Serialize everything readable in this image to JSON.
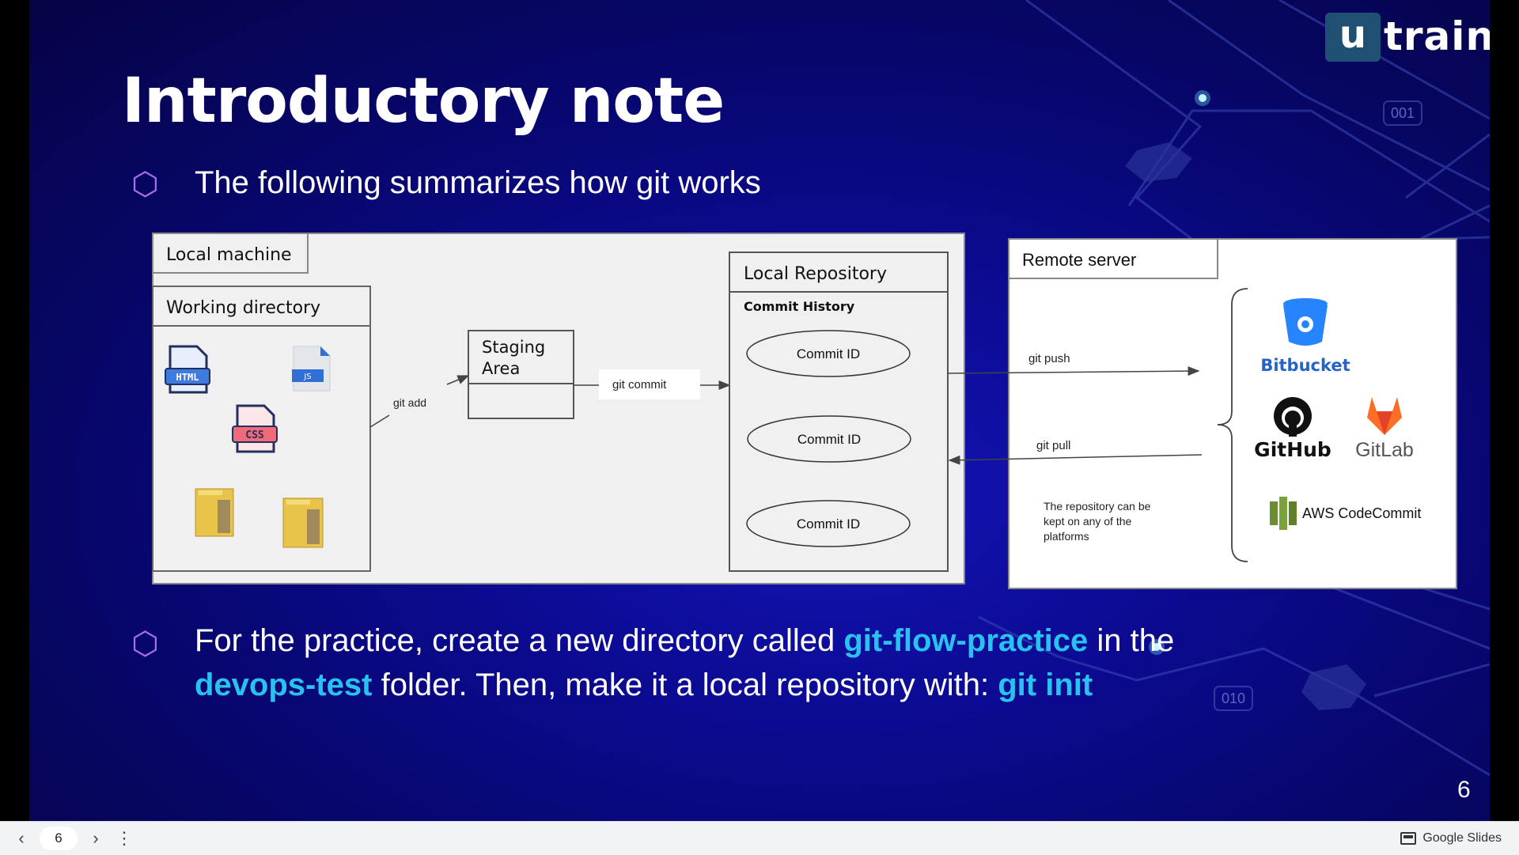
{
  "brand": {
    "logo_u": "u",
    "logo_text": "train"
  },
  "slide": {
    "title": "Introductory note",
    "bullet1": "The following summarizes how git works",
    "bullet2": {
      "p1": "For the practice, create a new directory called ",
      "h1": "git-flow-practice",
      "p2": " in the",
      "h2": "devops-test",
      "p3": " folder. Then, make it a local repository  with: ",
      "h3": "git init"
    },
    "page_number": "6",
    "decor_labels": [
      "001",
      "010"
    ]
  },
  "diagram": {
    "local_machine": "Local machine",
    "working_directory": "Working directory",
    "files": {
      "html": "HTML",
      "js": "JS",
      "css": "CSS"
    },
    "git_add": "git add",
    "staging_line1": "Staging",
    "staging_line2": "Area",
    "git_commit": "git commit",
    "local_repository": "Local Repository",
    "commit_history": "Commit History",
    "commits": [
      "Commit ID",
      "Commit ID",
      "Commit ID"
    ],
    "git_push": "git push",
    "git_pull": "git pull",
    "remote_server": "Remote server",
    "remote_note": [
      "The repository can be",
      "kept on any of the",
      "platforms"
    ],
    "platforms": {
      "bitbucket": "Bitbucket",
      "github": "GitHub",
      "gitlab": "GitLab",
      "aws": "AWS CodeCommit"
    }
  },
  "viewer": {
    "page_value": "6",
    "app_label": "Google Slides"
  },
  "colors": {
    "highlight": "#29c2ee",
    "bullet": "#a86cf0",
    "bitbucket": "#2684ff",
    "gitlab": "#fc6d26",
    "aws": "#6b8f2e"
  }
}
